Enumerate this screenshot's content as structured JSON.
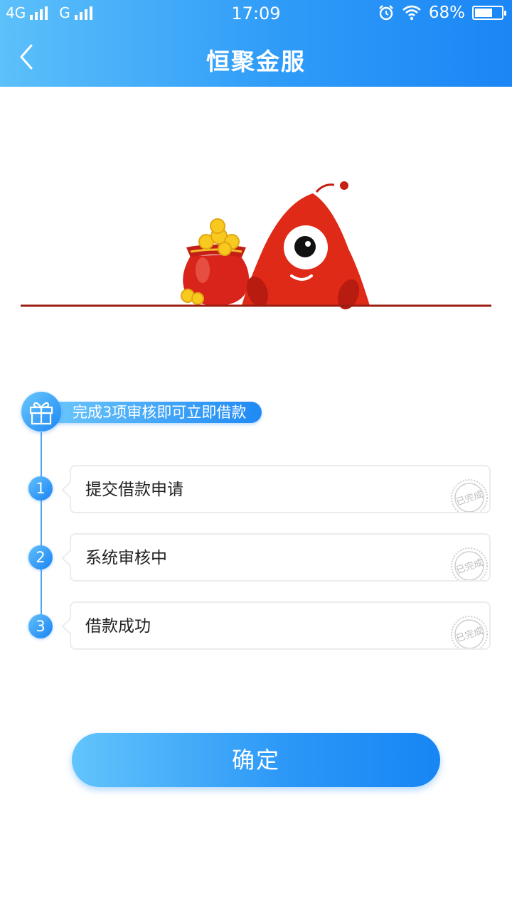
{
  "status_bar": {
    "network_1": "4G",
    "network_2": "G",
    "time": "17:09",
    "battery_percent": "68%",
    "battery_level": 0.68,
    "icons": [
      "signal-icon",
      "alarm-icon",
      "wifi-icon",
      "battery-icon"
    ]
  },
  "nav": {
    "title": "恒聚金服",
    "back_icon": "chevron-left-icon"
  },
  "steps": {
    "banner_text": "完成3项审核即可立即借款",
    "banner_icon": "gift-icon",
    "items": [
      {
        "number": "1",
        "label": "提交借款申请",
        "stamp": "已完成"
      },
      {
        "number": "2",
        "label": "系统审核中",
        "stamp": "已完成"
      },
      {
        "number": "3",
        "label": "借款成功",
        "stamp": "已完成"
      }
    ]
  },
  "confirm_label": "确定",
  "colors": {
    "primary_start": "#5cc0fa",
    "primary_end": "#1b86f5",
    "mascot_red": "#e02a18",
    "ground_line": "#9b1d12"
  }
}
